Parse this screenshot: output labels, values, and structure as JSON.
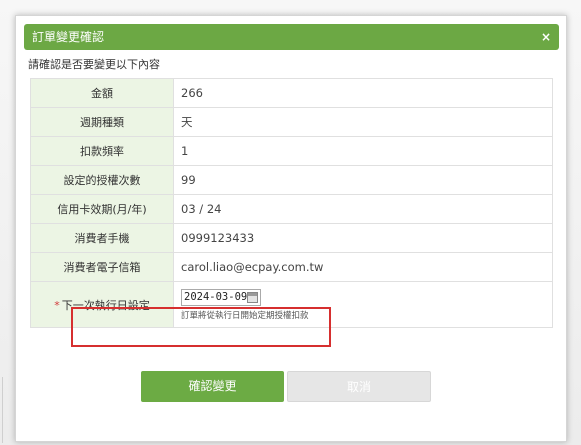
{
  "dialog": {
    "title": "訂單變更確認",
    "close_symbol": "×",
    "intro": "請確認是否要變更以下內容"
  },
  "rows": [
    {
      "label": "金額",
      "value": "266"
    },
    {
      "label": "週期種類",
      "value": "天"
    },
    {
      "label": "扣款頻率",
      "value": "1"
    },
    {
      "label": "設定的授權次數",
      "value": "99"
    },
    {
      "label": "信用卡效期(月/年)",
      "value": "03 / 24"
    },
    {
      "label": "消費者手機",
      "value": "0999123433"
    },
    {
      "label": "消費者電子信箱",
      "value": "carol.liao@ecpay.com.tw"
    }
  ],
  "next_date": {
    "required_mark": "*",
    "label": "下一次執行日設定",
    "value": "2024-03-09",
    "hint": "訂單將從執行日開始定期授權扣款"
  },
  "buttons": {
    "confirm": "確認變更",
    "cancel": "取消"
  },
  "colors": {
    "header_green": "#6ca844",
    "label_bg": "#ecf5e4",
    "highlight_red": "#d62f2f",
    "cancel_gray": "#e6e6e6"
  }
}
